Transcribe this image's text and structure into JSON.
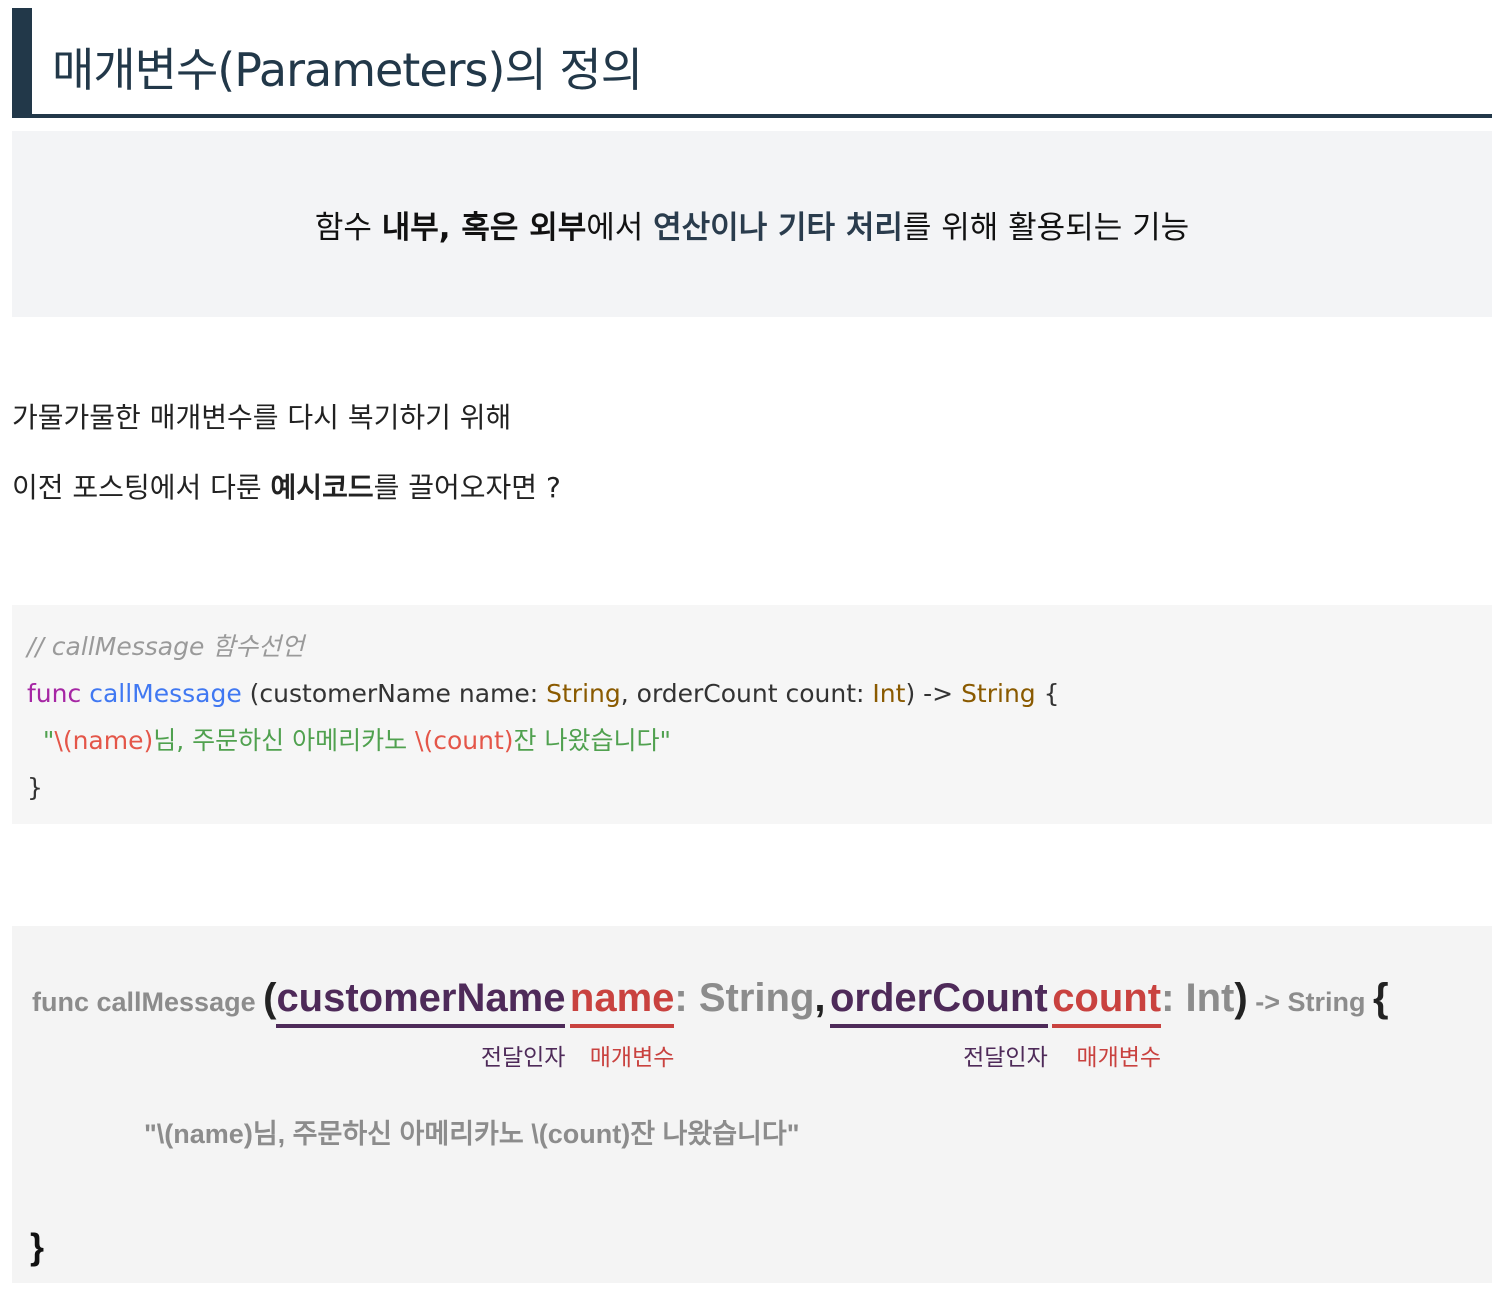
{
  "heading": {
    "title": "매개변수(Parameters)의 정의"
  },
  "definition": {
    "part1": "함수 ",
    "part2_bold": "내부, 혹은 외부",
    "part3": "에서 ",
    "part4_accent": "연산이나 기타 처리",
    "part5": "를 위해 활용되는 기능"
  },
  "paragraphs": {
    "p1": "가물가물한 매개변수를 다시 복기하기 위해",
    "p2_before": "이전 포스팅에서 다룬 ",
    "p2_bold": "예시코드",
    "p2_after": "를 끌어오자면 ?"
  },
  "code": {
    "comment": "// callMessage 함수선언",
    "kw_func": "func",
    "fn_name": "callMessage",
    "params_open": " (customerName name: ",
    "type_string": "String",
    "params_mid": ", orderCount count: ",
    "type_int": "Int",
    "params_close": ") -> ",
    "return_type": "String",
    "brace_open": " {",
    "indent": "  ",
    "str_quote_open": "\"",
    "interp_name": "\\(name)",
    "str_mid": "님, 주문하신 아메리카노 ",
    "interp_count": "\\(count)",
    "str_end": "잔 나왔습니다\"",
    "brace_close": "}"
  },
  "diagram": {
    "func_label": "func callMessage ",
    "paren_open": "(",
    "arg1": "customerName",
    "param1": "name",
    "colon1": ": String",
    "comma": ",",
    "arg2": "orderCount",
    "param2": "count",
    "colon2": ": Int",
    "paren_close": ")",
    "arrow_type": " -> String ",
    "brace_open": "{",
    "label_arg": "전달인자",
    "label_param": "매개변수",
    "string_line": "\"\\(name)님, 주문하신 아메리카노 \\(count)잔 나왔습니다\"",
    "brace_close": "}"
  },
  "colors": {
    "heading": "#223849",
    "argument_underline": "#4e2a59",
    "parameter_underline": "#c9423f"
  }
}
